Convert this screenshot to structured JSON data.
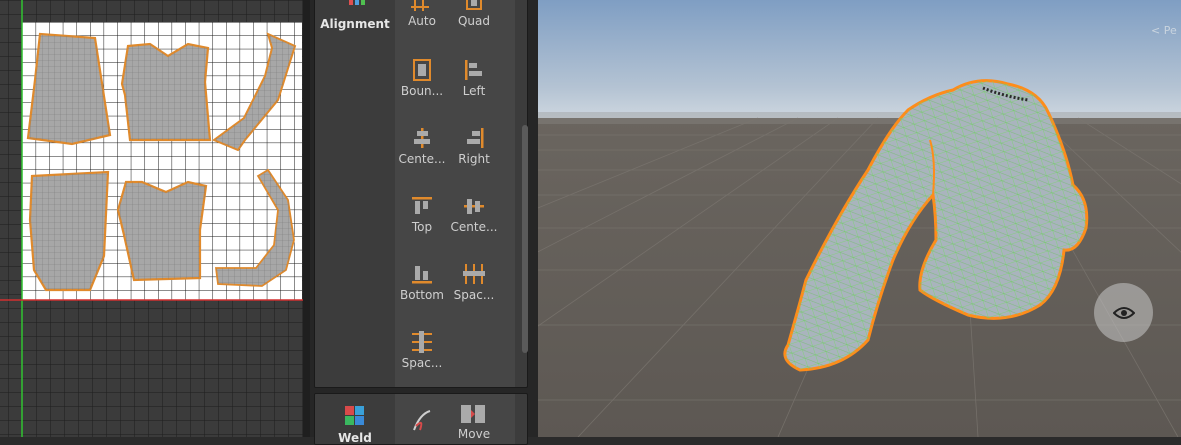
{
  "toolbar": {
    "alignment": {
      "title": "Alignment",
      "tools": [
        {
          "label": "Auto",
          "icon": "grid-pack-icon"
        },
        {
          "label": "Quad",
          "icon": "quad-icon"
        },
        {
          "label": "Boun...",
          "icon": "bounds-icon"
        },
        {
          "label": "Left",
          "icon": "align-left-icon"
        },
        {
          "label": "Cente...",
          "icon": "align-center-horizontal-icon"
        },
        {
          "label": "Right",
          "icon": "align-right-icon"
        },
        {
          "label": "Top",
          "icon": "align-top-icon"
        },
        {
          "label": "Cente...",
          "icon": "align-center-vertical-icon"
        },
        {
          "label": "Bottom",
          "icon": "align-bottom-icon"
        },
        {
          "label": "Spac...",
          "icon": "space-horizontal-icon"
        },
        {
          "label": "Spac...",
          "icon": "space-vertical-icon"
        }
      ]
    },
    "weld": {
      "title": "Weld",
      "tools": [
        {
          "label": "",
          "icon": "stitch-icon"
        },
        {
          "label": "Move",
          "icon": "move-icon"
        }
      ]
    }
  },
  "viewport": {
    "persp_label": "< Pe",
    "eye_icon": "eye-icon"
  },
  "colors": {
    "accent": "#e08a2c",
    "seam": "#ff8c1a",
    "wire": "#7ddc6a",
    "mesh": "#a9b4bd"
  }
}
